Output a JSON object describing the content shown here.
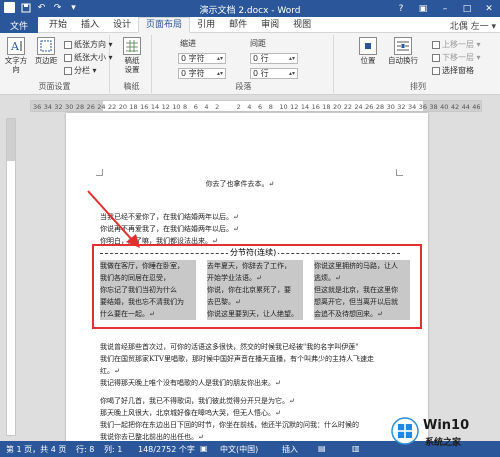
{
  "window": {
    "title": "演示文档 2.docx - Word",
    "user": "北偶 左一 ▾",
    "controls": [
      "?",
      "▣",
      "–",
      "□",
      "✕"
    ]
  },
  "quick_access": [
    "W",
    "💾",
    "↶",
    "↷",
    "▾"
  ],
  "tabs": {
    "file": "文件",
    "items": [
      "开始",
      "插入",
      "设计",
      "页面布局",
      "引用",
      "邮件",
      "审阅",
      "视图"
    ],
    "active": "页面布局"
  },
  "ribbon": {
    "page_setup": {
      "label": "页面设置",
      "text_direction": "文字方向",
      "margins": "页边距",
      "orientation": "纸张方向 ▾",
      "size": "纸张大小 ▾",
      "columns": "分栏 ▾"
    },
    "manuscript": {
      "label": "稿纸",
      "button": "稿纸\n设置"
    },
    "paragraph": {
      "label": "段落",
      "indent_title": "缩进",
      "spacing_title": "间距",
      "indent_left": "0 字符",
      "indent_right": "0 字符",
      "spacing_before": "0 行",
      "spacing_after": "0 行"
    },
    "arrange": {
      "label": "排列",
      "position": "位置",
      "wrap": "自动换行",
      "bring_forward": "上移一层 ▾",
      "send_backward": "下移一层 ▾",
      "selection_pane": "选择窗格"
    }
  },
  "ruler": {
    "ticks": [
      "36",
      "34",
      "32",
      "30",
      "28",
      "26",
      "24",
      "22",
      "20",
      "18",
      "16",
      "14",
      "12",
      "10",
      "8",
      "6",
      "4",
      "2",
      "",
      "2",
      "4",
      "6",
      "8",
      "10",
      "12",
      "14",
      "16",
      "18",
      "20",
      "22",
      "24",
      "26",
      "28",
      "30",
      "32",
      "34",
      "36",
      "38",
      "40",
      "42",
      "44",
      "46"
    ]
  },
  "document": {
    "title": "你去了也拿件去本。↵",
    "intro_lines": [
      "当我已经不爱你了，在我们结婚两年以后。↵",
      "你说再不再爱我了，在我们结婚两年以后。↵",
      "你明白，走了嘛，我们都设法出来。↵"
    ],
    "section_break_label": "分节符(连续)",
    "columns": [
      [
        "我做在客厅，你睡在卧室，",
        "我们各的同居在忍受，",
        "你忘记了我们当初为什么",
        "要结婚，我也忘不清我们为",
        "什么要在一起。↵"
      ],
      [
        "去年夏天，你辞去了工作，",
        "开始学业法语。↵",
        "你说，你在北京累死了，要",
        "去巴黎。↵",
        "你说这里要到天，让人绝望。"
      ],
      [
        "你说这里拥挤的马路，让人",
        "逃烦。↵",
        "但这就是北京，我在这里你",
        "想离开它，但当离开以后就",
        "会追不及待想回来。↵"
      ]
    ],
    "body_lines": [
      "我说曾经那些首次过，可你的活语这多很快，然交的时候我已经被\"我的名字叫伊莲\"",
      "我们在国贸那家KTV里唱歌，那时候中国好声音在播天直播，有个叫弗少的主持人飞速走",
      "红。↵",
      "我记得那天晚上唯个没有唱歌的人是我们的朋友你出来。↵",
      "你喝了好几首，我已不得歌词，我们彼此觉得分开只是为它。↵",
      "那天晚上风很大，北京城好像在嗥呜大哭，但无人悟心。↵",
      "我们一起把你在东边出日下回的时节，你坐在前线，他还半沉默的问我：什么时候的",
      "我说你去已整北前出的出任也。↵"
    ]
  },
  "status_bar": {
    "page": "第 1 页，共 4 页",
    "row": "行: 8",
    "col": "列: 1",
    "words": "148/2752 个字",
    "lang": "中文(中国)",
    "mode": "插入"
  },
  "watermark": {
    "line1": "Win10",
    "line2": "系统之家"
  }
}
